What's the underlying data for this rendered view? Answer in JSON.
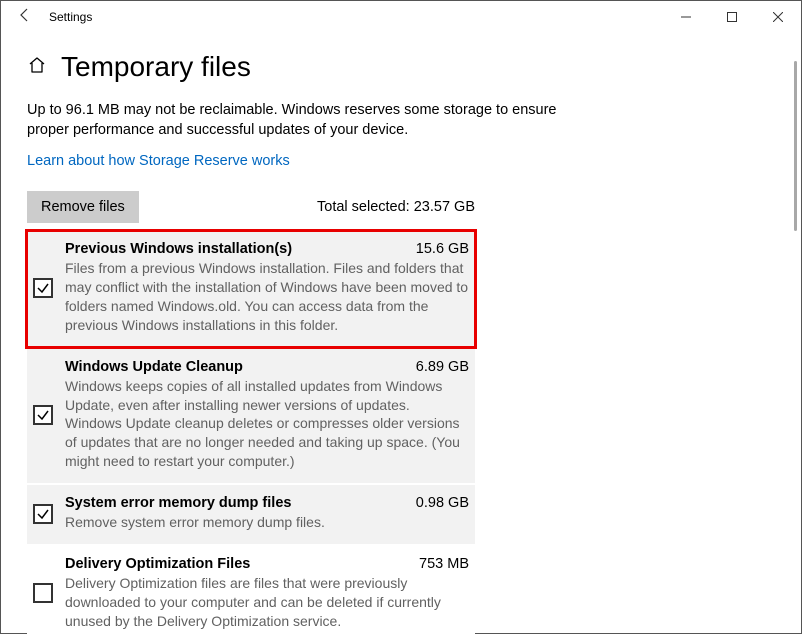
{
  "window": {
    "title": "Settings"
  },
  "page": {
    "heading": "Temporary files",
    "intro": "Up to 96.1 MB may not be reclaimable. Windows reserves some storage to ensure proper performance and successful updates of your device.",
    "link": "Learn about how Storage Reserve works",
    "remove_label": "Remove files",
    "total_label": "Total selected:",
    "total_value": "23.57 GB"
  },
  "items": [
    {
      "name": "Previous Windows installation(s)",
      "size": "15.6 GB",
      "desc": "Files from a previous Windows installation.  Files and folders that may conflict with the installation of Windows have been moved to folders named Windows.old.  You can access data from the previous Windows installations in this folder.",
      "checked": true,
      "highlighted": true
    },
    {
      "name": "Windows Update Cleanup",
      "size": "6.89 GB",
      "desc": "Windows keeps copies of all installed updates from Windows Update, even after installing newer versions of updates. Windows Update cleanup deletes or compresses older versions of updates that are no longer needed and taking up space. (You might need to restart your computer.)",
      "checked": true,
      "highlighted": false
    },
    {
      "name": "System error memory dump files",
      "size": "0.98 GB",
      "desc": "Remove system error memory dump files.",
      "checked": true,
      "highlighted": false
    },
    {
      "name": "Delivery Optimization Files",
      "size": "753 MB",
      "desc": "Delivery Optimization files are files that were previously downloaded to your computer and can be deleted if currently unused by the Delivery Optimization service.",
      "checked": false,
      "highlighted": false
    }
  ]
}
